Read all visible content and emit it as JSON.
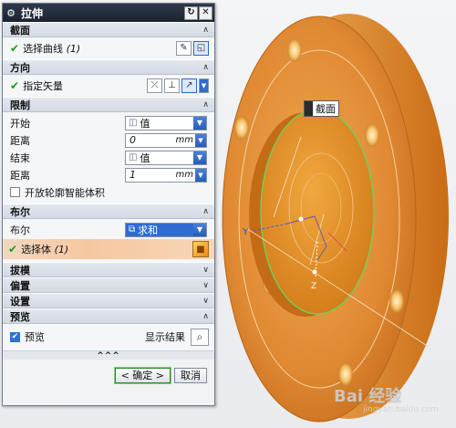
{
  "dialog": {
    "title": "拉伸",
    "sections": {
      "section": {
        "header": "截面",
        "select_curve_label": "选择曲线",
        "select_curve_count": "(1)"
      },
      "direction": {
        "header": "方向",
        "vector_label": "指定矢量"
      },
      "limits": {
        "header": "限制",
        "start_label": "开始",
        "start_value": "值",
        "start_distance_label": "距离",
        "start_distance_value": "0",
        "end_label": "结束",
        "end_value": "值",
        "end_distance_label": "距离",
        "end_distance_value": "1",
        "unit": "mm",
        "open_profile_label": "开放轮廓智能体积"
      },
      "boolean": {
        "header": "布尔",
        "boolean_label": "布尔",
        "boolean_value": "求和",
        "select_body_label": "选择体",
        "select_body_count": "(1)"
      },
      "draft": {
        "header": "拔模"
      },
      "offset": {
        "header": "偏置"
      },
      "settings": {
        "header": "设置"
      },
      "preview": {
        "header": "预览",
        "preview_label": "预览",
        "show_result_label": "显示结果"
      }
    },
    "more_label": "^^^",
    "ok_label": "< 确定 >",
    "cancel_label": "取消"
  },
  "viewport": {
    "tooltip": "截面",
    "axis_y": "Y",
    "axis_z": "Z",
    "watermark": "Bai 经验",
    "watermark_sub": "jingyan.baidu.com"
  },
  "colors": {
    "accent": "#2d6fd6",
    "part_orange": "#e38a2e",
    "titlebar": "#1f2836"
  }
}
